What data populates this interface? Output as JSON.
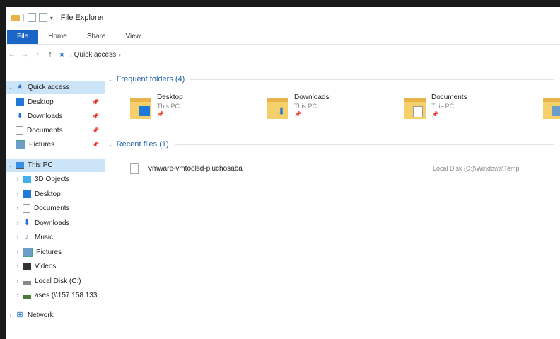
{
  "window": {
    "title": "File Explorer"
  },
  "ribbon": {
    "tabs": [
      "File",
      "Home",
      "Share",
      "View"
    ]
  },
  "address": {
    "crumb": "Quick access"
  },
  "nav": {
    "quick_access": "Quick access",
    "quick_items": [
      "Desktop",
      "Downloads",
      "Documents",
      "Pictures"
    ],
    "this_pc": "This PC",
    "pc_items": [
      "3D Objects",
      "Desktop",
      "Documents",
      "Downloads",
      "Music",
      "Pictures",
      "Videos",
      "Local Disk (C:)",
      "ases (\\\\157.158.133."
    ],
    "network": "Network"
  },
  "frequent": {
    "header": "Frequent folders (4)",
    "folders": [
      {
        "name": "Desktop",
        "location": "This PC"
      },
      {
        "name": "Downloads",
        "location": "This PC"
      },
      {
        "name": "Documents",
        "location": "This PC"
      }
    ]
  },
  "recent": {
    "header": "Recent files (1)",
    "files": [
      {
        "name": "vmware-vmtoolsd-pluchosaba",
        "location": "Local Disk (C:)\\Windows\\Temp"
      }
    ]
  },
  "colors": {
    "accent": "#1a66c6",
    "selection": "#cce4f7",
    "folder": "#e8b44a",
    "header": "#1e5fa8"
  },
  "icons": {
    "quick_access": "star-icon",
    "desktop": "desktop-icon",
    "downloads": "download-arrow-icon",
    "documents": "document-icon",
    "pictures": "pictures-icon",
    "this_pc": "computer-icon",
    "music": "music-note-icon",
    "videos": "video-icon",
    "disk": "drive-icon",
    "network": "network-icon"
  }
}
